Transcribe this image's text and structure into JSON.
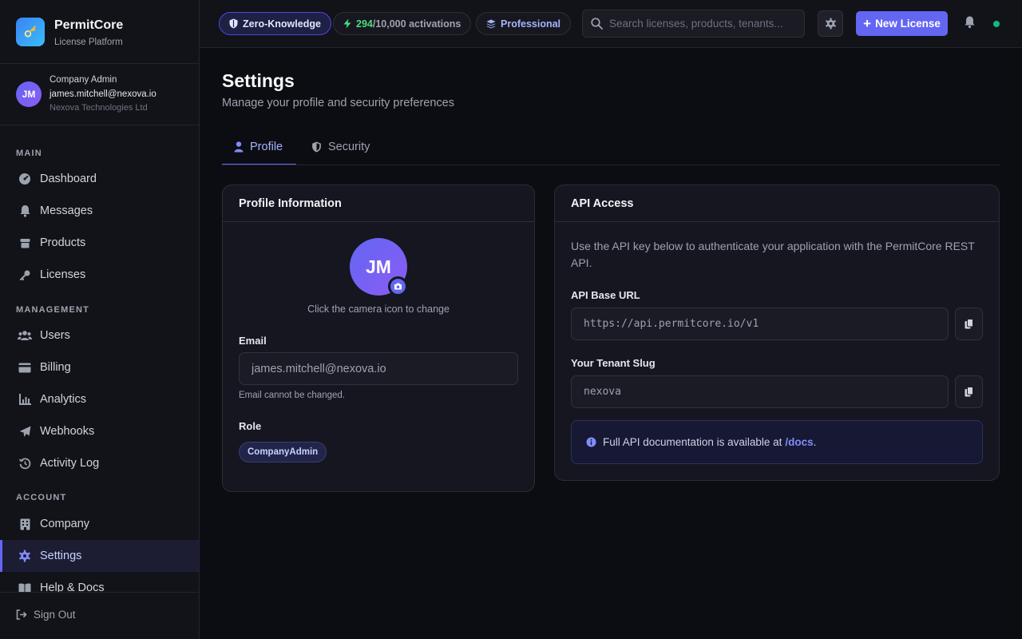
{
  "brand": {
    "title": "PermitCore",
    "subtitle": "License Platform",
    "logo_icon": "key-icon"
  },
  "user": {
    "initials": "JM",
    "role": "Company Admin",
    "email": "james.mitchell@nexova.io",
    "company": "Nexova Technologies Ltd"
  },
  "sidebar": {
    "sections": [
      {
        "label": "MAIN",
        "items": [
          {
            "label": "Dashboard",
            "icon": "gauge-icon"
          },
          {
            "label": "Messages",
            "icon": "bell-icon"
          },
          {
            "label": "Products",
            "icon": "box-icon"
          },
          {
            "label": "Licenses",
            "icon": "key-icon"
          }
        ]
      },
      {
        "label": "MANAGEMENT",
        "items": [
          {
            "label": "Users",
            "icon": "users-icon"
          },
          {
            "label": "Billing",
            "icon": "credit-card-icon"
          },
          {
            "label": "Analytics",
            "icon": "chart-icon"
          },
          {
            "label": "Webhooks",
            "icon": "paper-plane-icon"
          },
          {
            "label": "Activity Log",
            "icon": "history-icon"
          }
        ]
      },
      {
        "label": "ACCOUNT",
        "items": [
          {
            "label": "Company",
            "icon": "building-icon"
          },
          {
            "label": "Settings",
            "icon": "gear-icon",
            "active": true
          },
          {
            "label": "Help & Docs",
            "icon": "book-icon"
          }
        ]
      }
    ],
    "sign_out": "Sign Out"
  },
  "topbar": {
    "zk_label": "Zero-Knowledge",
    "activations_used": "294",
    "activations_total": "/10,000",
    "activations_label": "activations",
    "plan": "Professional",
    "search_placeholder": "Search licenses, products, tenants...",
    "new_button": "New License"
  },
  "page": {
    "title": "Settings",
    "subtitle": "Manage your profile and security preferences",
    "tabs": [
      {
        "label": "Profile",
        "active": true
      },
      {
        "label": "Security",
        "active": false
      }
    ]
  },
  "profile": {
    "heading": "Profile Information",
    "initials": "JM",
    "avatar_hint": "Click the camera icon to change",
    "email_label": "Email",
    "email_value": "james.mitchell@nexova.io",
    "email_help": "Email cannot be changed.",
    "role_label": "Role",
    "role_value": "CompanyAdmin"
  },
  "api": {
    "heading": "API Access",
    "description": "Use the API key below to authenticate your application with the PermitCore REST API.",
    "base_url_label": "API Base URL",
    "base_url": "https://api.permitcore.io/v1",
    "slug_label": "Your Tenant Slug",
    "slug": "nexova",
    "info_text": "Full API documentation is available at",
    "info_link": "/docs",
    "info_end": "."
  },
  "colors": {
    "accent": "#6366f1",
    "success": "#10b981",
    "background": "#0c0d13",
    "surface": "#151620"
  }
}
